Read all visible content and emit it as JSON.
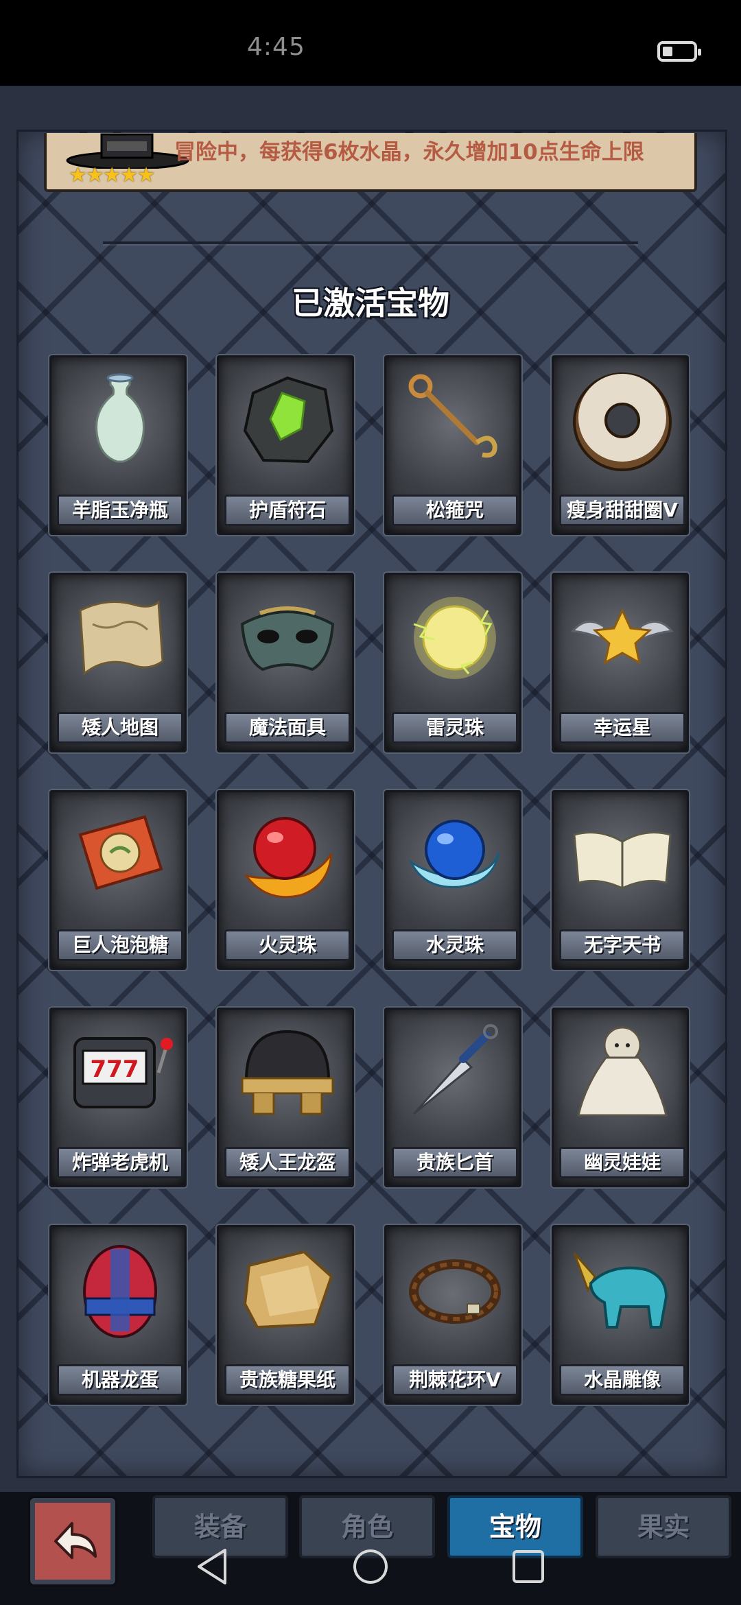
{
  "status_bar": {
    "time": "4:45"
  },
  "banner": {
    "text": "冒险中，每获得6枚水晶，永久增加10点生命上限",
    "stars": "★★★★★"
  },
  "section_title": "已激活宝物",
  "treasures": [
    {
      "name": "羊脂玉净瓶",
      "icon": "jade-vase-icon"
    },
    {
      "name": "护盾符石",
      "icon": "shield-rune-icon"
    },
    {
      "name": "松箍咒",
      "icon": "staff-icon"
    },
    {
      "name": "瘦身甜甜圈V",
      "icon": "donut-icon"
    },
    {
      "name": "矮人地图",
      "icon": "map-scroll-icon"
    },
    {
      "name": "魔法面具",
      "icon": "magic-mask-icon"
    },
    {
      "name": "雷灵珠",
      "icon": "thunder-orb-icon"
    },
    {
      "name": "幸运星",
      "icon": "lucky-star-icon"
    },
    {
      "name": "巨人泡泡糖",
      "icon": "bubblegum-icon"
    },
    {
      "name": "火灵珠",
      "icon": "fire-orb-icon"
    },
    {
      "name": "水灵珠",
      "icon": "water-orb-icon"
    },
    {
      "name": "无字天书",
      "icon": "blank-book-icon"
    },
    {
      "name": "炸弹老虎机",
      "icon": "slot-machine-icon"
    },
    {
      "name": "矮人王龙盔",
      "icon": "helmet-icon"
    },
    {
      "name": "贵族匕首",
      "icon": "dagger-icon"
    },
    {
      "name": "幽灵娃娃",
      "icon": "ghost-doll-icon"
    },
    {
      "name": "机器龙蛋",
      "icon": "robot-egg-icon"
    },
    {
      "name": "贵族糖果纸",
      "icon": "candy-wrapper-icon"
    },
    {
      "name": "荆棘花环V",
      "icon": "thorn-wreath-icon"
    },
    {
      "name": "水晶雕像",
      "icon": "crystal-statue-icon"
    }
  ],
  "tabs": [
    {
      "label": "装备",
      "active": false
    },
    {
      "label": "角色",
      "active": false
    },
    {
      "label": "宝物",
      "active": true
    },
    {
      "label": "果实",
      "active": false
    }
  ],
  "colors": {
    "panel": "#404a5f",
    "banner_text": "#b55b44",
    "active_tab": "#1f6fa4",
    "back_button": "#b2514d"
  }
}
